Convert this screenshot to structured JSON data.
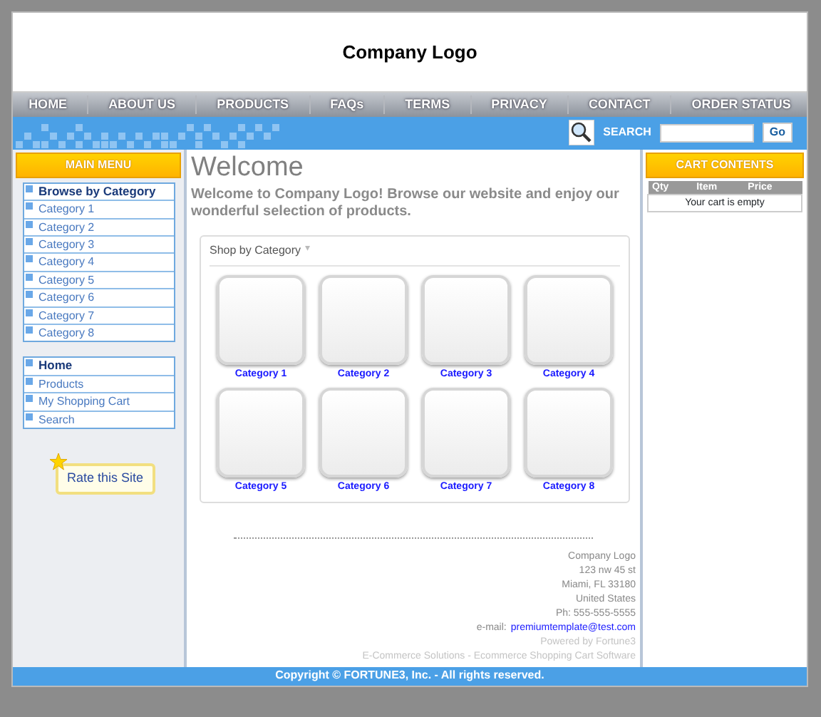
{
  "header": {
    "logo": "Company Logo"
  },
  "nav": [
    "HOME",
    "ABOUT US",
    "PRODUCTS",
    "FAQs",
    "TERMS",
    "PRIVACY",
    "CONTACT",
    "ORDER STATUS"
  ],
  "search": {
    "label": "SEARCH",
    "button": "Go"
  },
  "main_menu": {
    "title": "MAIN MENU",
    "groups": [
      {
        "items": [
          {
            "kind": "heading",
            "label": "Browse by Category"
          },
          {
            "kind": "link",
            "label": "Category 1"
          },
          {
            "kind": "link",
            "label": "Category 2"
          },
          {
            "kind": "link",
            "label": "Category 3"
          },
          {
            "kind": "link",
            "label": "Category 4"
          },
          {
            "kind": "link",
            "label": "Category 5"
          },
          {
            "kind": "link",
            "label": "Category 6"
          },
          {
            "kind": "link",
            "label": "Category 7"
          },
          {
            "kind": "link",
            "label": "Category 8"
          }
        ]
      },
      {
        "items": [
          {
            "kind": "heading",
            "label": "Home"
          },
          {
            "kind": "link",
            "label": "Products"
          },
          {
            "kind": "link",
            "label": "My Shopping Cart"
          },
          {
            "kind": "link",
            "label": "Search"
          }
        ]
      }
    ],
    "rate_button": "Rate this Site"
  },
  "content": {
    "title": "Welcome",
    "intro": "Welcome to  Company Logo! Browse our website and enjoy our wonderful selection of products.",
    "shop": {
      "title": "Shop by Category",
      "arrow": "▾",
      "categories": [
        "Category 1",
        "Category 2",
        "Category 3",
        "Category 4",
        "Category 5",
        "Category 6",
        "Category 7",
        "Category 8"
      ]
    },
    "address": [
      "Company Logo",
      "123 nw 45 st",
      "Miami, FL 33180",
      "United States",
      "Ph: 555-555-5555"
    ],
    "email_label": "e-mail:",
    "email": "premiumtemplate@test.com",
    "powered": "Powered by Fortune3",
    "tagline": "E-Commerce Solutions - Ecommerce Shopping Cart Software"
  },
  "cart": {
    "title": "CART CONTENTS",
    "columns": [
      "Qty",
      "Item",
      "Price"
    ],
    "empty": "Your cart is empty"
  },
  "footer": "Copyright © FORTUNE3, Inc. - All rights reserved."
}
